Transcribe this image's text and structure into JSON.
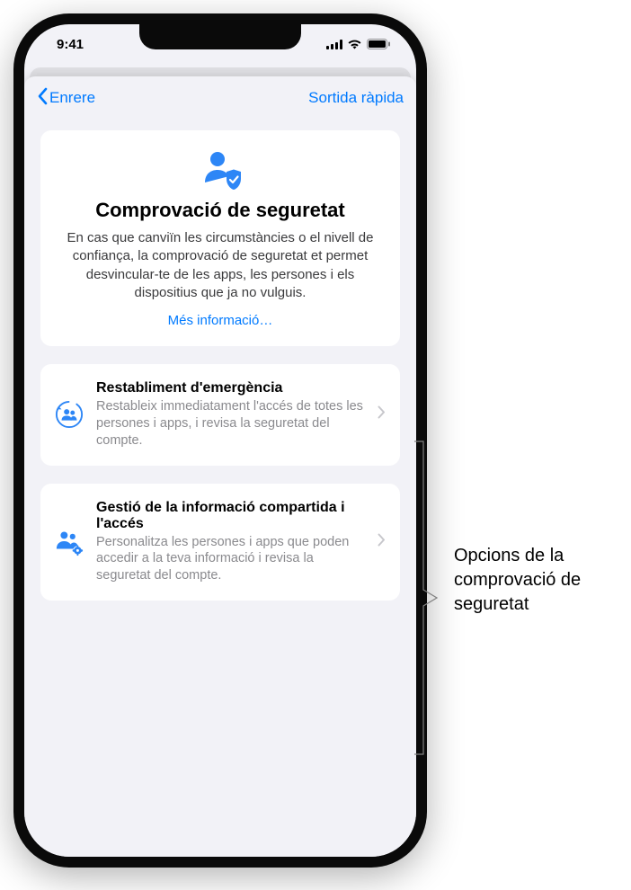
{
  "status_bar": {
    "time": "9:41"
  },
  "nav": {
    "back_label": "Enrere",
    "quick_exit_label": "Sortida ràpida"
  },
  "hero": {
    "title": "Comprovació de seguretat",
    "description": "En cas que canviïn les circumstàncies o el nivell de confiança, la comprovació de seguretat et permet desvincular-te de les apps, les persones i els dispositius que ja no vulguis.",
    "link_label": "Més informació…"
  },
  "options": [
    {
      "title": "Restabliment d'emergència",
      "description": "Restableix immediatament l'accés de totes les persones i apps, i revisa la seguretat del compte."
    },
    {
      "title": "Gestió de la informació compartida i l'accés",
      "description": "Personalitza les persones i apps que poden accedir a la teva informació i revisa la seguretat del compte."
    }
  ],
  "callout": {
    "text": "Opcions de la comprovació de seguretat"
  },
  "colors": {
    "accent": "#007aff",
    "background": "#f2f2f7",
    "card": "#ffffff",
    "secondary_text": "#8a8a8e"
  }
}
